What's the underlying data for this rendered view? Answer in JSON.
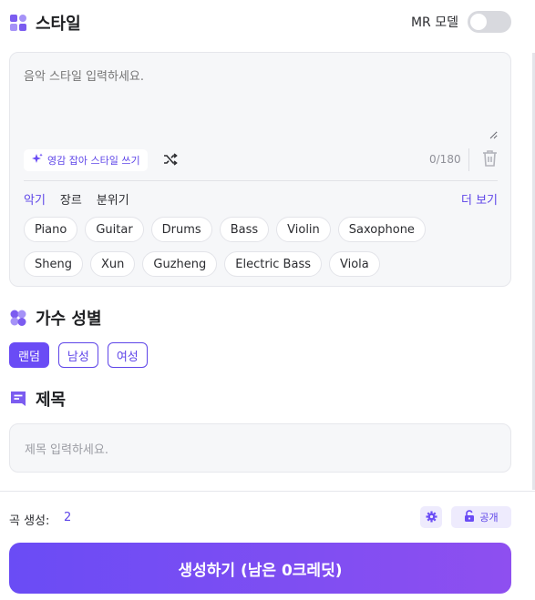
{
  "style_section": {
    "title": "스타일",
    "mr_label": "MR 모델",
    "placeholder": "음악 스타일 입력하세요.",
    "inspire_label": "영감 잡아 스타일 쓰기",
    "char_count": "0/180",
    "tabs": [
      "악기",
      "장르",
      "분위기"
    ],
    "active_tab": "악기",
    "more_label": "더 보기",
    "chips_row1": [
      "Piano",
      "Guitar",
      "Drums",
      "Bass",
      "Violin",
      "Saxophone"
    ],
    "chips_row2": [
      "Sheng",
      "Xun",
      "Guzheng",
      "Electric Bass",
      "Viola"
    ]
  },
  "gender_section": {
    "title": "가수 성별",
    "options": [
      "랜덤",
      "남성",
      "여성"
    ],
    "selected": "랜덤"
  },
  "title_section": {
    "title": "제목",
    "placeholder": "제목 입력하세요."
  },
  "footer": {
    "count_label": "곡 생성:",
    "count_value": "2",
    "public_label": "공개",
    "generate_label": "생성하기 (남은 0크레딧)"
  },
  "colors": {
    "accent": "#6a4cf5",
    "accent_text": "#5e45e8",
    "icon": "#7b5cf0",
    "toggle_off": "#d8d9de"
  },
  "icons": {
    "style": "grid-shapes-icon",
    "inspire": "sparkle-icon",
    "shuffle": "shuffle-icon",
    "trash": "trash-icon",
    "gender": "gender-icon",
    "title": "bookmark-text-icon",
    "settings": "gear-icon",
    "public": "unlock-icon"
  }
}
